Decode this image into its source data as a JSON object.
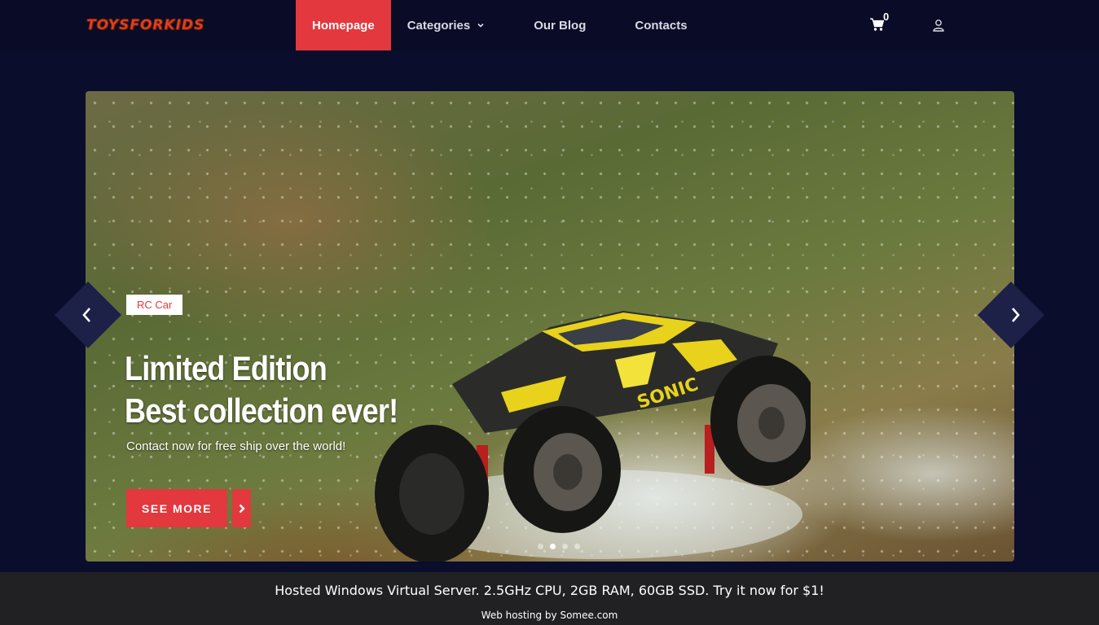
{
  "header": {
    "logo_text": "TOYSFORKIDS",
    "nav": [
      {
        "label": "Homepage",
        "active": true
      },
      {
        "label": "Categories",
        "has_dropdown": true
      },
      {
        "label": "Our Blog"
      },
      {
        "label": "Contacts"
      }
    ],
    "cart_count": "0",
    "cart_icon": "shopping-cart-icon",
    "user_icon": "user-icon"
  },
  "slider": {
    "category_tag": "RC Car",
    "headline_line1": "Limited Edition",
    "headline_line2": "Best collection ever!",
    "subline": "Contact now for free ship over the world!",
    "button_label": "SEE MORE",
    "active_slide": 1,
    "slide_count": 4,
    "prev_icon": "chevron-left-icon",
    "next_icon": "chevron-right-icon"
  },
  "banner": {
    "main_text": "Hosted Windows Virtual Server. 2.5GHz CPU, 2GB RAM, 60GB SSD. Try it now for $1!",
    "sub_text": "Web hosting by Somee.com"
  },
  "colors": {
    "accent": "#e3383d",
    "background": "#0b0d2d",
    "header": "#0a0b27",
    "banner": "#212123"
  }
}
